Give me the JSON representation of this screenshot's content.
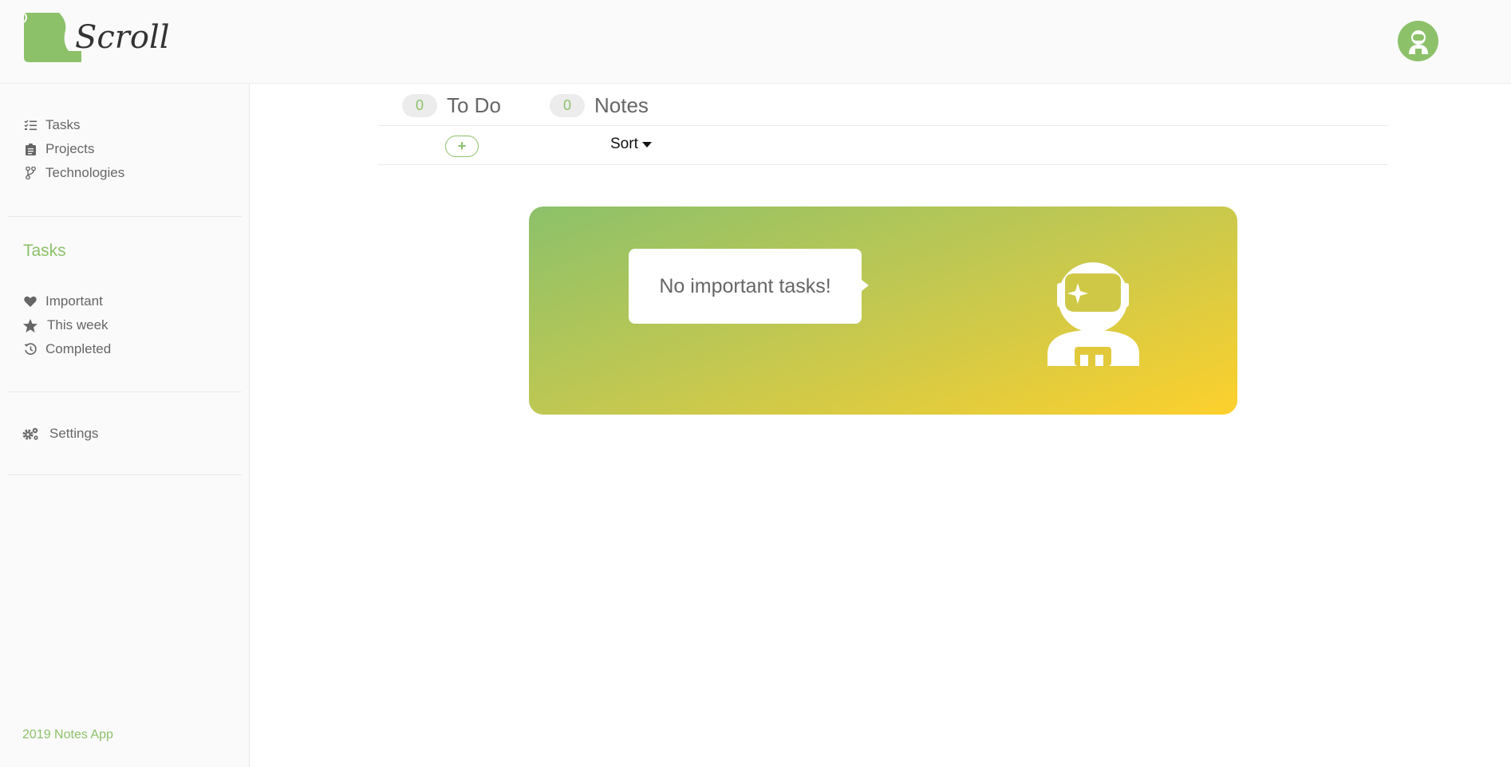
{
  "header": {
    "logo_text": "Scroll",
    "accent_color": "#8cc16a"
  },
  "sidebar": {
    "nav_top": [
      {
        "label": "Tasks",
        "icon": "tasks-list-icon"
      },
      {
        "label": "Projects",
        "icon": "clipboard-icon"
      },
      {
        "label": "Technologies",
        "icon": "code-branch-icon"
      }
    ],
    "section_title": "Tasks",
    "nav_tasks": [
      {
        "label": "Important",
        "icon": "heart-icon"
      },
      {
        "label": "This week",
        "icon": "star-icon"
      },
      {
        "label": "Completed",
        "icon": "history-icon"
      }
    ],
    "nav_settings": {
      "label": "Settings",
      "icon": "cogs-icon"
    },
    "footer": "2019 Notes App"
  },
  "main": {
    "tabs": [
      {
        "count": "0",
        "label": "To Do"
      },
      {
        "count": "0",
        "label": "Notes"
      }
    ],
    "toolbar": {
      "add_label": "+",
      "sort_label": "Sort"
    },
    "banner": {
      "message": "No important tasks!",
      "gradient_start": "#8cc16a",
      "gradient_end": "#fdd02c"
    }
  }
}
